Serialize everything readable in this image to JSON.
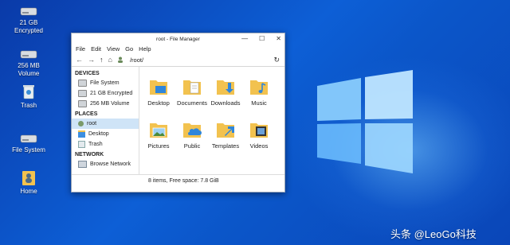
{
  "desktop": {
    "icons": [
      {
        "label1": "21 GB",
        "label2": "Encrypted"
      },
      {
        "label1": "256 MB",
        "label2": "Volume"
      },
      {
        "label1": "Trash",
        "label2": ""
      },
      {
        "label1": "File System",
        "label2": ""
      },
      {
        "label1": "Home",
        "label2": ""
      }
    ],
    "watermark": "头条 @LeoGo科技"
  },
  "window": {
    "title": "root - File Manager",
    "controls": {
      "minimize": "—",
      "maximize": "☐",
      "close": "✕"
    },
    "menu": [
      "File",
      "Edit",
      "View",
      "Go",
      "Help"
    ],
    "path": "/root/",
    "sidebar": {
      "devices_header": "DEVICES",
      "devices": [
        "File System",
        "21 GB Encrypted",
        "256 MB Volume"
      ],
      "places_header": "PLACES",
      "places": [
        "root",
        "Desktop",
        "Trash"
      ],
      "network_header": "NETWORK",
      "network": [
        "Browse Network"
      ]
    },
    "files": [
      "Desktop",
      "Documents",
      "Downloads",
      "Music",
      "Pictures",
      "Public",
      "Templates",
      "Videos"
    ],
    "status": "8 items, Free space: 7.8 GiB"
  }
}
